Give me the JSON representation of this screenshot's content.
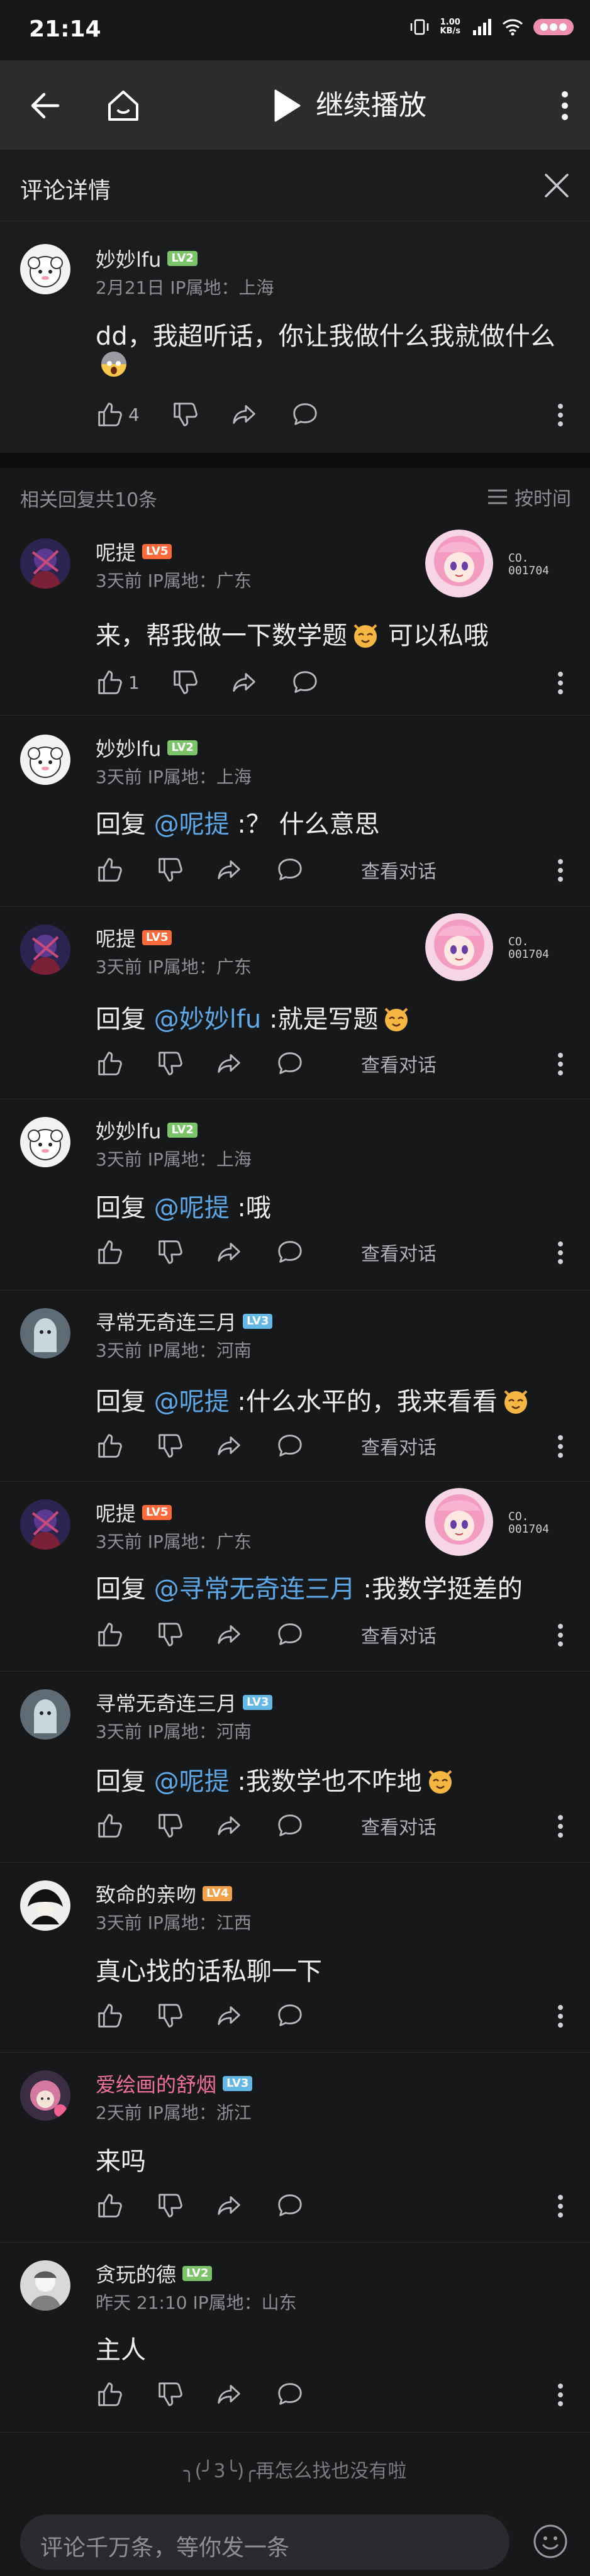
{
  "status_bar": {
    "time": "21:14",
    "speed_value": "1.00",
    "speed_unit": "KB/s"
  },
  "topbar": {
    "continue_label": "继续播放"
  },
  "detail": {
    "title": "评论详情"
  },
  "main_comment": {
    "user": "妙妙lfu",
    "level": "LV2",
    "meta": "2月21日 IP属地：上海",
    "text": "dd，我超听话，你让我做什么我就做什么",
    "likes": "4"
  },
  "replies_header": {
    "count": "相关回复共10条",
    "sort": "按时间"
  },
  "replies": [
    {
      "user": "呢提",
      "level": "LV5",
      "meta": "3天前 IP属地：广东",
      "prefix": "",
      "mention": "",
      "text": "来，帮我做一下数学题",
      "text2": "可以私哦",
      "likes": "1",
      "badge": "CO.\n001704",
      "view": ""
    },
    {
      "user": "妙妙lfu",
      "level": "LV2",
      "meta": "3天前 IP属地：上海",
      "prefix": "回复 ",
      "mention": "@呢提",
      "text": " :？ 什么意思",
      "likes": "",
      "view": "查看对话"
    },
    {
      "user": "呢提",
      "level": "LV5",
      "meta": "3天前 IP属地：广东",
      "prefix": "回复 ",
      "mention": "@妙妙lfu",
      "text": " :就是写题",
      "likes": "",
      "badge": "CO.\n001704",
      "view": "查看对话"
    },
    {
      "user": "妙妙lfu",
      "level": "LV2",
      "meta": "3天前 IP属地：上海",
      "prefix": "回复 ",
      "mention": "@呢提",
      "text": " :哦",
      "likes": "",
      "view": "查看对话"
    },
    {
      "user": "寻常无奇连三月",
      "level": "LV3",
      "meta": "3天前 IP属地：河南",
      "prefix": "回复 ",
      "mention": "@呢提",
      "text": " :什么水平的，我来看看",
      "likes": "",
      "view": "查看对话"
    },
    {
      "user": "呢提",
      "level": "LV5",
      "meta": "3天前 IP属地：广东",
      "prefix": "回复 ",
      "mention": "@寻常无奇连三月",
      "text": " :我数学挺差的",
      "likes": "",
      "badge": "CO.\n001704",
      "view": "查看对话"
    },
    {
      "user": "寻常无奇连三月",
      "level": "LV3",
      "meta": "3天前 IP属地：河南",
      "prefix": "回复 ",
      "mention": "@呢提",
      "text": " :我数学也不咋地",
      "likes": "",
      "view": "查看对话"
    },
    {
      "user": "致命的亲吻",
      "level": "LV4",
      "meta": "3天前 IP属地：江西",
      "prefix": "",
      "mention": "",
      "text": "真心找的话私聊一下",
      "likes": "",
      "view": ""
    },
    {
      "user": "爱绘画的舒烟",
      "level": "LV3",
      "meta": "2天前 IP属地：浙江",
      "prefix": "",
      "mention": "",
      "text": "来吗",
      "likes": "",
      "view": ""
    },
    {
      "user": "贪玩的德",
      "level": "LV2",
      "meta": "昨天 21:10 IP属地：山东",
      "prefix": "",
      "mention": "",
      "text": "主人",
      "likes": "",
      "view": ""
    }
  ],
  "end_tip": "╮(╯3╰)╭再怎么找也没有啦",
  "input": {
    "placeholder": "评论千万条，等你发一条"
  },
  "colors": {
    "mention": "#5ea8e8",
    "lv2": "#7cc46a",
    "lv3": "#63b8e6",
    "lv4": "#f0a14a",
    "lv5": "#ff6a3d",
    "pink_name": "#f1709a"
  }
}
